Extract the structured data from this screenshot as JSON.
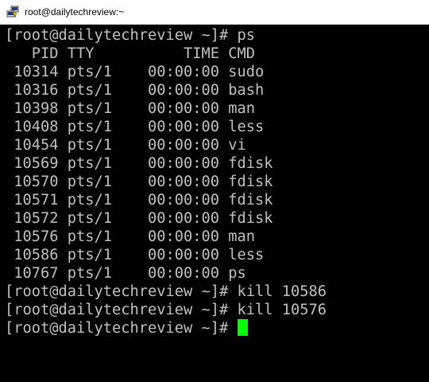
{
  "window": {
    "title": "root@dailytechreview:~",
    "icon": "putty-icon"
  },
  "colors": {
    "terminal_background": "#000000",
    "terminal_text": "#c0c0c0",
    "cursor": "#00ff00",
    "titlebar_background": "#ffffff"
  },
  "terminal": {
    "lines": [
      "[root@dailytechreview ~]# ps",
      "   PID TTY          TIME CMD",
      " 10314 pts/1    00:00:00 sudo",
      " 10316 pts/1    00:00:00 bash",
      " 10398 pts/1    00:00:00 man",
      " 10408 pts/1    00:00:00 less",
      " 10454 pts/1    00:00:00 vi",
      " 10569 pts/1    00:00:00 fdisk",
      " 10570 pts/1    00:00:00 fdisk",
      " 10571 pts/1    00:00:00 fdisk",
      " 10572 pts/1    00:00:00 fdisk",
      " 10576 pts/1    00:00:00 man",
      " 10586 pts/1    00:00:00 less",
      " 10767 pts/1    00:00:00 ps",
      "[root@dailytechreview ~]# kill 10586",
      "[root@dailytechreview ~]# kill 10576"
    ],
    "current_prompt": "[root@dailytechreview ~]# "
  }
}
